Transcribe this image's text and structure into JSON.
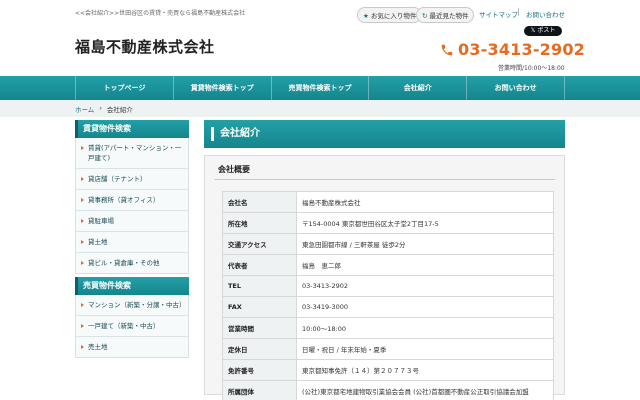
{
  "header": {
    "tagline": "<<会社紹介>>世田谷区の賃貸・売買なら福島不動産株式会社",
    "fav_label": "お気に入り物件",
    "recent_label": "最近見た物件",
    "sitemap_label": "サイトマップ",
    "contact_label": "お問い合わせ",
    "logo": "福島不動産株式会社",
    "post_label": "𝕏 ポスト",
    "phone": "03-3413-2902",
    "hours": "営業時間/10:00～18:00"
  },
  "nav": {
    "items": [
      "トップページ",
      "賃貸物件検索トップ",
      "売買物件検索トップ",
      "会社紹介",
      "お問い合わせ"
    ]
  },
  "breadcrumb": {
    "home": "ホーム",
    "sep": "›",
    "current": "会社紹介"
  },
  "sidebar": {
    "rent_title": "賃貸物件検索",
    "rent_items": [
      "賃貸(アパート・マンション・一戸建て)",
      "貸店舗（テナント）",
      "貸事務所（貸オフィス）",
      "貸駐車場",
      "貸土地",
      "貸ビル・貸倉庫・その他"
    ],
    "sale_title": "売買物件検索",
    "sale_items": [
      "マンション（新築・分譲・中古）",
      "一戸建て（新築・中古）",
      "売土地"
    ]
  },
  "main": {
    "title": "会社紹介",
    "section": "会社概要",
    "rows": [
      {
        "k": "会社名",
        "v": "福島不動産株式会社"
      },
      {
        "k": "所在地",
        "v": "〒154-0004 東京都世田谷区太子堂2丁目17-5"
      },
      {
        "k": "交通アクセス",
        "v": "東急田園都市線 / 三軒茶屋 徒歩2分"
      },
      {
        "k": "代表者",
        "v": "福島　恵二郎"
      },
      {
        "k": "TEL",
        "v": "03-3413-2902"
      },
      {
        "k": "FAX",
        "v": "03-3419-3000"
      },
      {
        "k": "営業時間",
        "v": "10:00～18:00"
      },
      {
        "k": "定休日",
        "v": "日曜・祝日 / 年末年始・夏季"
      },
      {
        "k": "免許番号",
        "v": "東京都知事免許（１４）第２０７７３号"
      },
      {
        "k": "所属団体",
        "v": "(公社)東京都宅地建物取引業協会会員 (公社)首都圏不動産公正取引協議会加盟"
      }
    ]
  },
  "colors": {
    "accent": "#15858c",
    "phone": "#e86a1e"
  }
}
